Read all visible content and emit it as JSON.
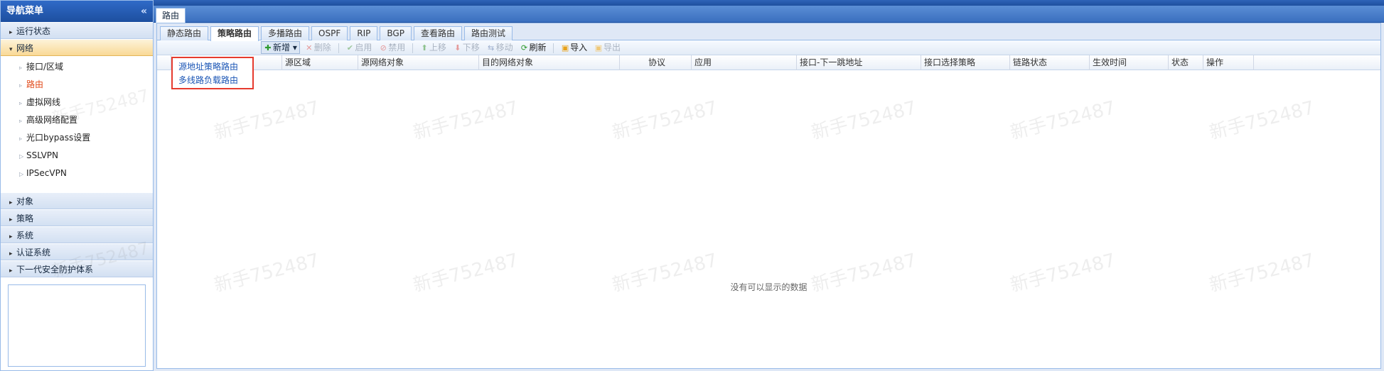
{
  "sidebar": {
    "title": "导航菜单",
    "collapse_icon": "double-chevron-left-icon",
    "groups_top": [
      {
        "label": "运行状态",
        "expanded": false
      },
      {
        "label": "网络",
        "expanded": true
      }
    ],
    "network_items": [
      {
        "label": "接口/区域"
      },
      {
        "label": "路由",
        "active": true
      },
      {
        "label": "虚拟网线"
      },
      {
        "label": "高级网络配置"
      },
      {
        "label": "光口bypass设置"
      },
      {
        "label": "SSLVPN"
      },
      {
        "label": "IPSecVPN"
      }
    ],
    "groups_bottom": [
      {
        "label": "对象"
      },
      {
        "label": "策略"
      },
      {
        "label": "系统"
      },
      {
        "label": "认证系统"
      },
      {
        "label": "下一代安全防护体系"
      }
    ]
  },
  "main": {
    "tab": "路由",
    "subtabs": [
      "静态路由",
      "策略路由",
      "多播路由",
      "OSPF",
      "RIP",
      "BGP",
      "查看路由",
      "路由测试"
    ],
    "active_subtab": "策略路由",
    "toolbar": {
      "add": "新增",
      "delete": "删除",
      "enable": "启用",
      "disable": "禁用",
      "move_up": "上移",
      "move_down": "下移",
      "move": "移动",
      "refresh": "刷新",
      "import": "导入",
      "export": "导出"
    },
    "columns": [
      "源区域",
      "源网络对象",
      "目的网络对象",
      "协议",
      "应用",
      "接口-下一跳地址",
      "接口选择策略",
      "链路状态",
      "生效时间",
      "状态",
      "操作"
    ],
    "add_menu": [
      "源地址策略路由",
      "多线路负载路由"
    ],
    "empty_message": "没有可以显示的数据",
    "watermark": "新手752487"
  },
  "colors": {
    "accent": "#1d4f9f",
    "active_nav": "#e14a19",
    "menu_border": "#e63b2e",
    "link": "#1a55b5"
  }
}
